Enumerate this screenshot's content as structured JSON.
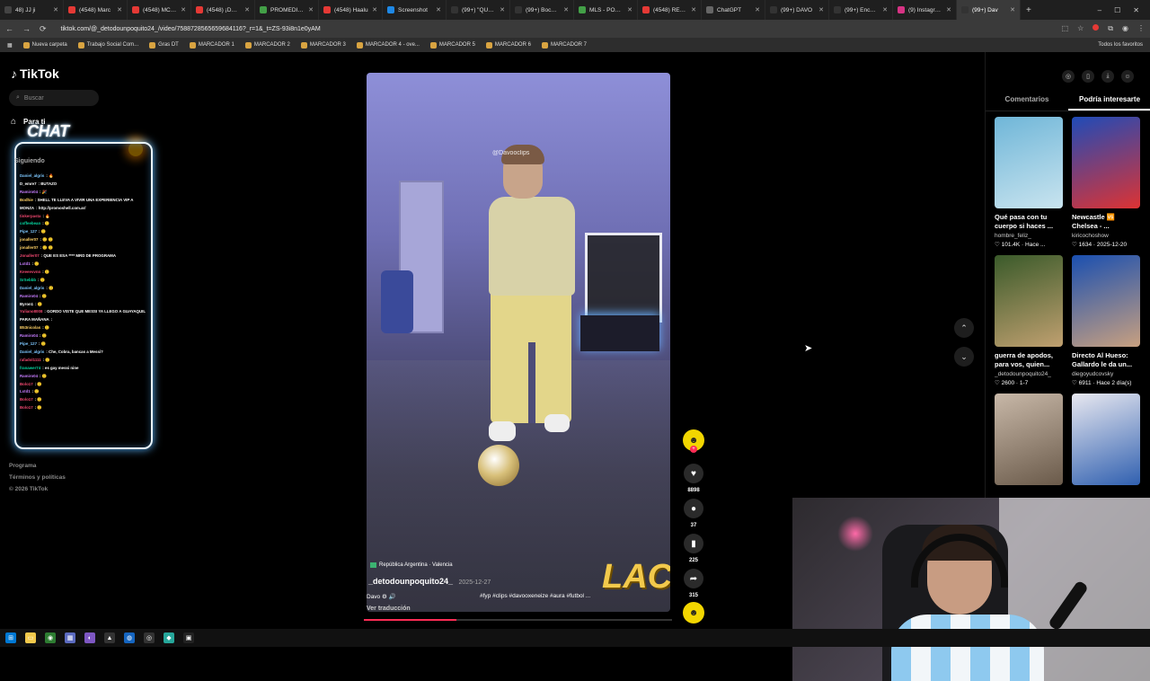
{
  "browser": {
    "tabs": [
      {
        "label": "48) JJ ji",
        "color": "#444"
      },
      {
        "label": "(4548) Marc",
        "color": "#e53935"
      },
      {
        "label": "(4548) MC Ki",
        "color": "#e53935"
      },
      {
        "label": "(4548) ¡DOBI",
        "color": "#e53935"
      },
      {
        "label": "PROMEDIOS",
        "color": "#43a047"
      },
      {
        "label": "(4548) Haalu",
        "color": "#e53935"
      },
      {
        "label": "Screenshot",
        "color": "#1e88e5"
      },
      {
        "label": "(99+) \"QUERI",
        "color": "#333"
      },
      {
        "label": "(99+) Boca vs",
        "color": "#333"
      },
      {
        "label": "MLS - POSIC",
        "color": "#43a047"
      },
      {
        "label": "(4548) RETO",
        "color": "#e53935"
      },
      {
        "label": "ChatGPT",
        "color": "#666"
      },
      {
        "label": "(99+) DAVO",
        "color": "#333"
      },
      {
        "label": "(99+) Encuen",
        "color": "#333"
      },
      {
        "label": "(9) Instagram",
        "color": "#d63384"
      },
      {
        "label": "(99+) Dav",
        "color": "#333"
      }
    ],
    "new_tab": "+",
    "window_controls": [
      "–",
      "☐",
      "✕"
    ],
    "url": "tiktok.com/@_detodounpoquito24_/video/7588728565659684116?_r=1&_t=ZS-93i8n1e0yAM",
    "bookmarks": [
      "Nueva carpeta",
      "Trabajo Social Com...",
      "Gras DT",
      "MARCADOR 1",
      "MARCADOR 2",
      "MARCADOR 3",
      "MARCADOR 4 - ove...",
      "MARCADOR 5",
      "MARCADOR 6",
      "MARCADOR 7"
    ],
    "bookmarks_right": "Todos los favoritos"
  },
  "sidebar": {
    "logo": "TikTok",
    "search_placeholder": "Buscar",
    "nav": {
      "for_you": "Para ti",
      "following": "Siguiendo"
    },
    "footer": [
      "Programa",
      "Términos y políticas",
      "© 2026 TikTok"
    ]
  },
  "chat": {
    "title": "CHAT",
    "lines": [
      {
        "user": "Daniel_algris",
        "msg": "🔥",
        "color": "#7ec8ff"
      },
      {
        "user": "D_emre7",
        "msg": "BUTAZO",
        "color": "#fff"
      },
      {
        "user": "Ramiro04",
        "msg": "🎉",
        "color": "#c77dff"
      },
      {
        "user": "Bodhie",
        "msg": "SHELL TE LLEVA A VIVIR UNA EXPERIENCIA VIP A",
        "color": "#ffd166"
      },
      {
        "user": "MONZA",
        "msg": "http://promoshell.com.ar/",
        "color": "#fff"
      },
      {
        "user": "tinkerpasta",
        "msg": "🔥",
        "color": "#ef476f"
      },
      {
        "user": "coffeebean",
        "msg": "🙂",
        "color": "#06d6a0"
      },
      {
        "user": "Pipe_127",
        "msg": "🙂",
        "color": "#7ec8ff"
      },
      {
        "user": "jonaller07",
        "msg": "🙂 🙂",
        "color": "#ffd166"
      },
      {
        "user": "jonaller07",
        "msg": "🙂 🙂",
        "color": "#ffd166"
      },
      {
        "user": "Jonaller07",
        "msg": "QUE ES ESA **** MRD DE PROGRAMA",
        "color": "#ef476f"
      },
      {
        "user": "Lxtd1",
        "msg": "🙂",
        "color": "#c77dff"
      },
      {
        "user": "Keeeevvnn",
        "msg": "🙂",
        "color": "#ef476f"
      },
      {
        "user": "SrSebbb",
        "msg": "🙂",
        "color": "#06d6a0"
      },
      {
        "user": "Daniel_algris",
        "msg": "🙂",
        "color": "#7ec8ff"
      },
      {
        "user": "Ramiro04",
        "msg": "🙂",
        "color": "#c77dff"
      },
      {
        "user": "Byron1",
        "msg": "🙂",
        "color": "#fff"
      },
      {
        "user": "Yuliano8008",
        "msg": "GORDO VISTE QUE MESSI YA LLEGO A GUAYAQUIL",
        "color": "#ef476f"
      },
      {
        "user": "PARA MAÑANA",
        "msg": "",
        "color": "#fff"
      },
      {
        "user": "B53nicolas",
        "msg": "🙂",
        "color": "#ffd166"
      },
      {
        "user": "Ramiro04",
        "msg": "🙂",
        "color": "#c77dff"
      },
      {
        "user": "Pipe_127",
        "msg": "🙂",
        "color": "#7ec8ff"
      },
      {
        "user": "Daniel_algris",
        "msg": "Che, Cobra, bancas a Messi?",
        "color": "#7ec8ff"
      },
      {
        "user": "rafadol1111",
        "msg": "🙂",
        "color": "#ef476f"
      },
      {
        "user": "franawer74",
        "msg": "es gay messi nine",
        "color": "#06d6a0"
      },
      {
        "user": "Ramiro04",
        "msg": "🙂",
        "color": "#c77dff"
      },
      {
        "user": "Bolo17",
        "msg": "🙂",
        "color": "#ef476f"
      },
      {
        "user": "Lxtd1",
        "msg": "🙂",
        "color": "#c77dff"
      },
      {
        "user": "Bolo17",
        "msg": "🙂",
        "color": "#ef476f"
      },
      {
        "user": "Bolo17",
        "msg": "🙂",
        "color": "#ef476f"
      }
    ]
  },
  "video": {
    "watermark": "@Davooclips",
    "overlay_text": "LAC",
    "location": "República Argentina · Valencia",
    "author": "_detodounpoquito24_",
    "date": "2025-12-27",
    "description": "Davo ⚙ 🔊",
    "tags": "#fyp #clips #davooxeneize #aura #futbol ...",
    "translate": "Ver traducción",
    "progress": 0.3
  },
  "actions": {
    "likes": "8898",
    "comments": "37",
    "saves": "225",
    "shares": "315"
  },
  "right_panel": {
    "tabs": [
      "Comentarios",
      "Podría interesarte"
    ],
    "active_tab": 1,
    "cards": [
      {
        "title": "Qué pasa con tu cuerpo si haces ...",
        "author": "hombre_feliz_",
        "meta": "♡ 101.4K · Hace ...",
        "colors": [
          "#6fb6d8",
          "#c9e4ef"
        ]
      },
      {
        "title": "Newcastle 🆚 Chelsea - ...",
        "author": "kiricochoshow",
        "meta": "♡ 1634 · 2025-12-20",
        "colors": [
          "#1f4bb8",
          "#d33"
        ]
      },
      {
        "title": "guerra de apodos, para vos, quien...",
        "author": "_detodounpoquito24_",
        "meta": "♡ 2600 · 1-7",
        "colors": [
          "#3a5a2a",
          "#c0a070"
        ]
      },
      {
        "title": "Directo Al Hueso: Gallardo le da un...",
        "author": "diegoyudcovsky",
        "meta": "♡ 6911 · Hace 2 día(s)",
        "colors": [
          "#1a4fb0",
          "#c8a080"
        ]
      },
      {
        "title": "",
        "author": "",
        "meta": "",
        "colors": [
          "#c8b8a8",
          "#6a5a4a"
        ]
      },
      {
        "title": "",
        "author": "",
        "meta": "",
        "colors": [
          "#e8e8f0",
          "#3060b0"
        ]
      }
    ]
  }
}
